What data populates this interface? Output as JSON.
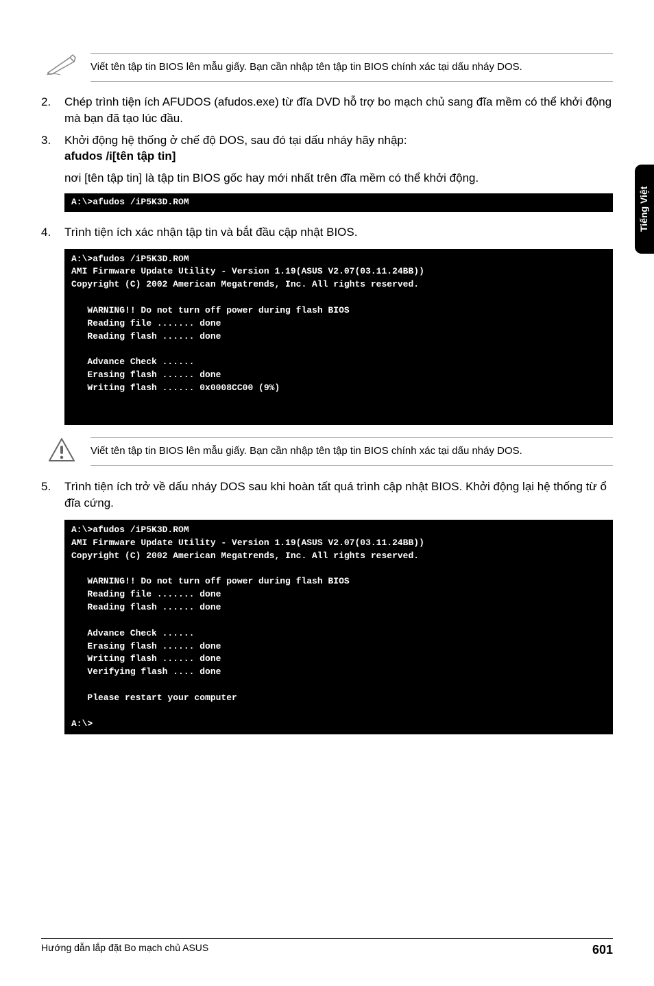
{
  "sideTab": "Tiếng Việt",
  "note1": "Viết tên tập tin BIOS lên mẫu giấy. Bạn cần nhập tên tập tin BIOS chính xác tại dấu nháy DOS.",
  "step2": {
    "num": "2.",
    "text": "Chép trình tiện ích AFUDOS (afudos.exe) từ đĩa DVD hỗ trợ bo mạch chủ sang đĩa mềm có thể khởi động mà bạn đã tạo lúc đầu."
  },
  "step3": {
    "num": "3.",
    "line1": "Khởi động hệ thống ở chế độ DOS, sau đó tại dấu nháy hãy nhập:",
    "bold": "afudos /i[tên tập tin]",
    "after": "nơi [tên tập tin] là tập tin BIOS gốc hay mới nhất trên đĩa mềm có thể khởi động."
  },
  "terminal1": "A:\\>afudos /iP5K3D.ROM",
  "step4": {
    "num": "4.",
    "text": "Trình tiện ích xác nhận tập tin và bắt đầu cập nhật BIOS."
  },
  "terminal2": "A:\\>afudos /iP5K3D.ROM\nAMI Firmware Update Utility - Version 1.19(ASUS V2.07(03.11.24BB))\nCopyright (C) 2002 American Megatrends, Inc. All rights reserved.\n\n   WARNING!! Do not turn off power during flash BIOS\n   Reading file ....... done\n   Reading flash ...... done\n\n   Advance Check ......\n   Erasing flash ...... done\n   Writing flash ...... 0x0008CC00 (9%)\n\n\n",
  "note2": "Viết tên tập tin BIOS lên mẫu giấy. Bạn cần nhập tên tập tin BIOS chính xác tại dấu nháy DOS.",
  "step5": {
    "num": "5.",
    "text": "Trình tiện ích trở về dấu nháy DOS sau khi hoàn tất quá trình cập nhật BIOS. Khởi động lại hệ thống từ ổ đĩa cứng."
  },
  "terminal3": "A:\\>afudos /iP5K3D.ROM\nAMI Firmware Update Utility - Version 1.19(ASUS V2.07(03.11.24BB))\nCopyright (C) 2002 American Megatrends, Inc. All rights reserved.\n\n   WARNING!! Do not turn off power during flash BIOS\n   Reading file ....... done\n   Reading flash ...... done\n\n   Advance Check ......\n   Erasing flash ...... done\n   Writing flash ...... done\n   Verifying flash .... done\n\n   Please restart your computer\n\nA:\\>",
  "footer": {
    "left": "Hướng dẫn lắp đặt Bo mạch chủ ASUS",
    "page": "601"
  }
}
